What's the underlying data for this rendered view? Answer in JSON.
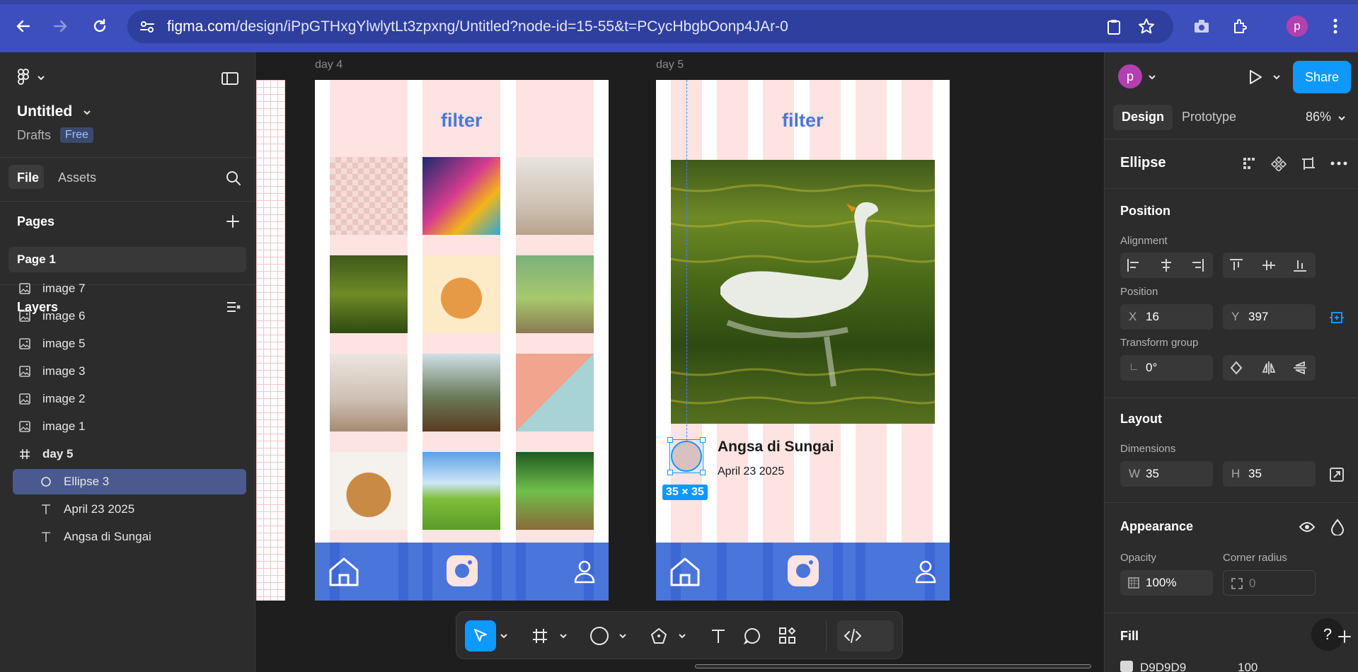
{
  "browser": {
    "url_host": "figma.com",
    "url_path": "/design/iPpGTHxgYlwlytLt3zpxng/Untitled?node-id=15-55&t=PCycHbgbOonp4JAr-0",
    "profile_initial": "p"
  },
  "file": {
    "name": "Untitled",
    "location": "Drafts",
    "plan_badge": "Free"
  },
  "left_tabs": {
    "file": "File",
    "assets": "Assets"
  },
  "pages": {
    "header": "Pages",
    "items": [
      "Page 1"
    ]
  },
  "layers": {
    "header": "Layers",
    "items": [
      {
        "label": "image 7",
        "type": "image"
      },
      {
        "label": "image 6",
        "type": "image"
      },
      {
        "label": "image 5",
        "type": "image"
      },
      {
        "label": "image 3",
        "type": "image"
      },
      {
        "label": "image 2",
        "type": "image"
      },
      {
        "label": "image 1",
        "type": "image"
      },
      {
        "label": "day 5",
        "type": "frame"
      },
      {
        "label": "Ellipse 3",
        "type": "ellipse",
        "selected": true
      },
      {
        "label": "April 23 2025",
        "type": "text"
      },
      {
        "label": "Angsa di Sungai",
        "type": "text"
      }
    ]
  },
  "canvas": {
    "frames": [
      {
        "name": "day 4",
        "title": "filter"
      },
      {
        "name": "day 5",
        "title": "filter",
        "post_title": "Angsa di Sungai",
        "post_date": "April 23 2025"
      }
    ],
    "selection_size": "35 × 35"
  },
  "right": {
    "profile_initial": "p",
    "share_label": "Share",
    "tabs": {
      "design": "Design",
      "prototype": "Prototype"
    },
    "zoom": "86%",
    "selection_name": "Ellipse",
    "position": {
      "header": "Position",
      "alignment_label": "Alignment",
      "position_label": "Position",
      "x_key": "X",
      "x": "16",
      "y_key": "Y",
      "y": "397",
      "transform_label": "Transform group",
      "rotation": "0°"
    },
    "layout": {
      "header": "Layout",
      "dimensions_label": "Dimensions",
      "w_key": "W",
      "w": "35",
      "h_key": "H",
      "h": "35"
    },
    "appearance": {
      "header": "Appearance",
      "opacity_label": "Opacity",
      "opacity": "100%",
      "radius_label": "Corner radius",
      "radius": "0"
    },
    "fill": {
      "header": "Fill",
      "hex": "D9D9D9",
      "opacity": "100"
    }
  },
  "colors": {
    "browser_chrome": "#3c4fbd",
    "accent_blue": "#0d99ff",
    "frame_stripe": "#fde3e1",
    "nav_blue": "#4a76db",
    "layer_selected": "#4a5a8f"
  }
}
